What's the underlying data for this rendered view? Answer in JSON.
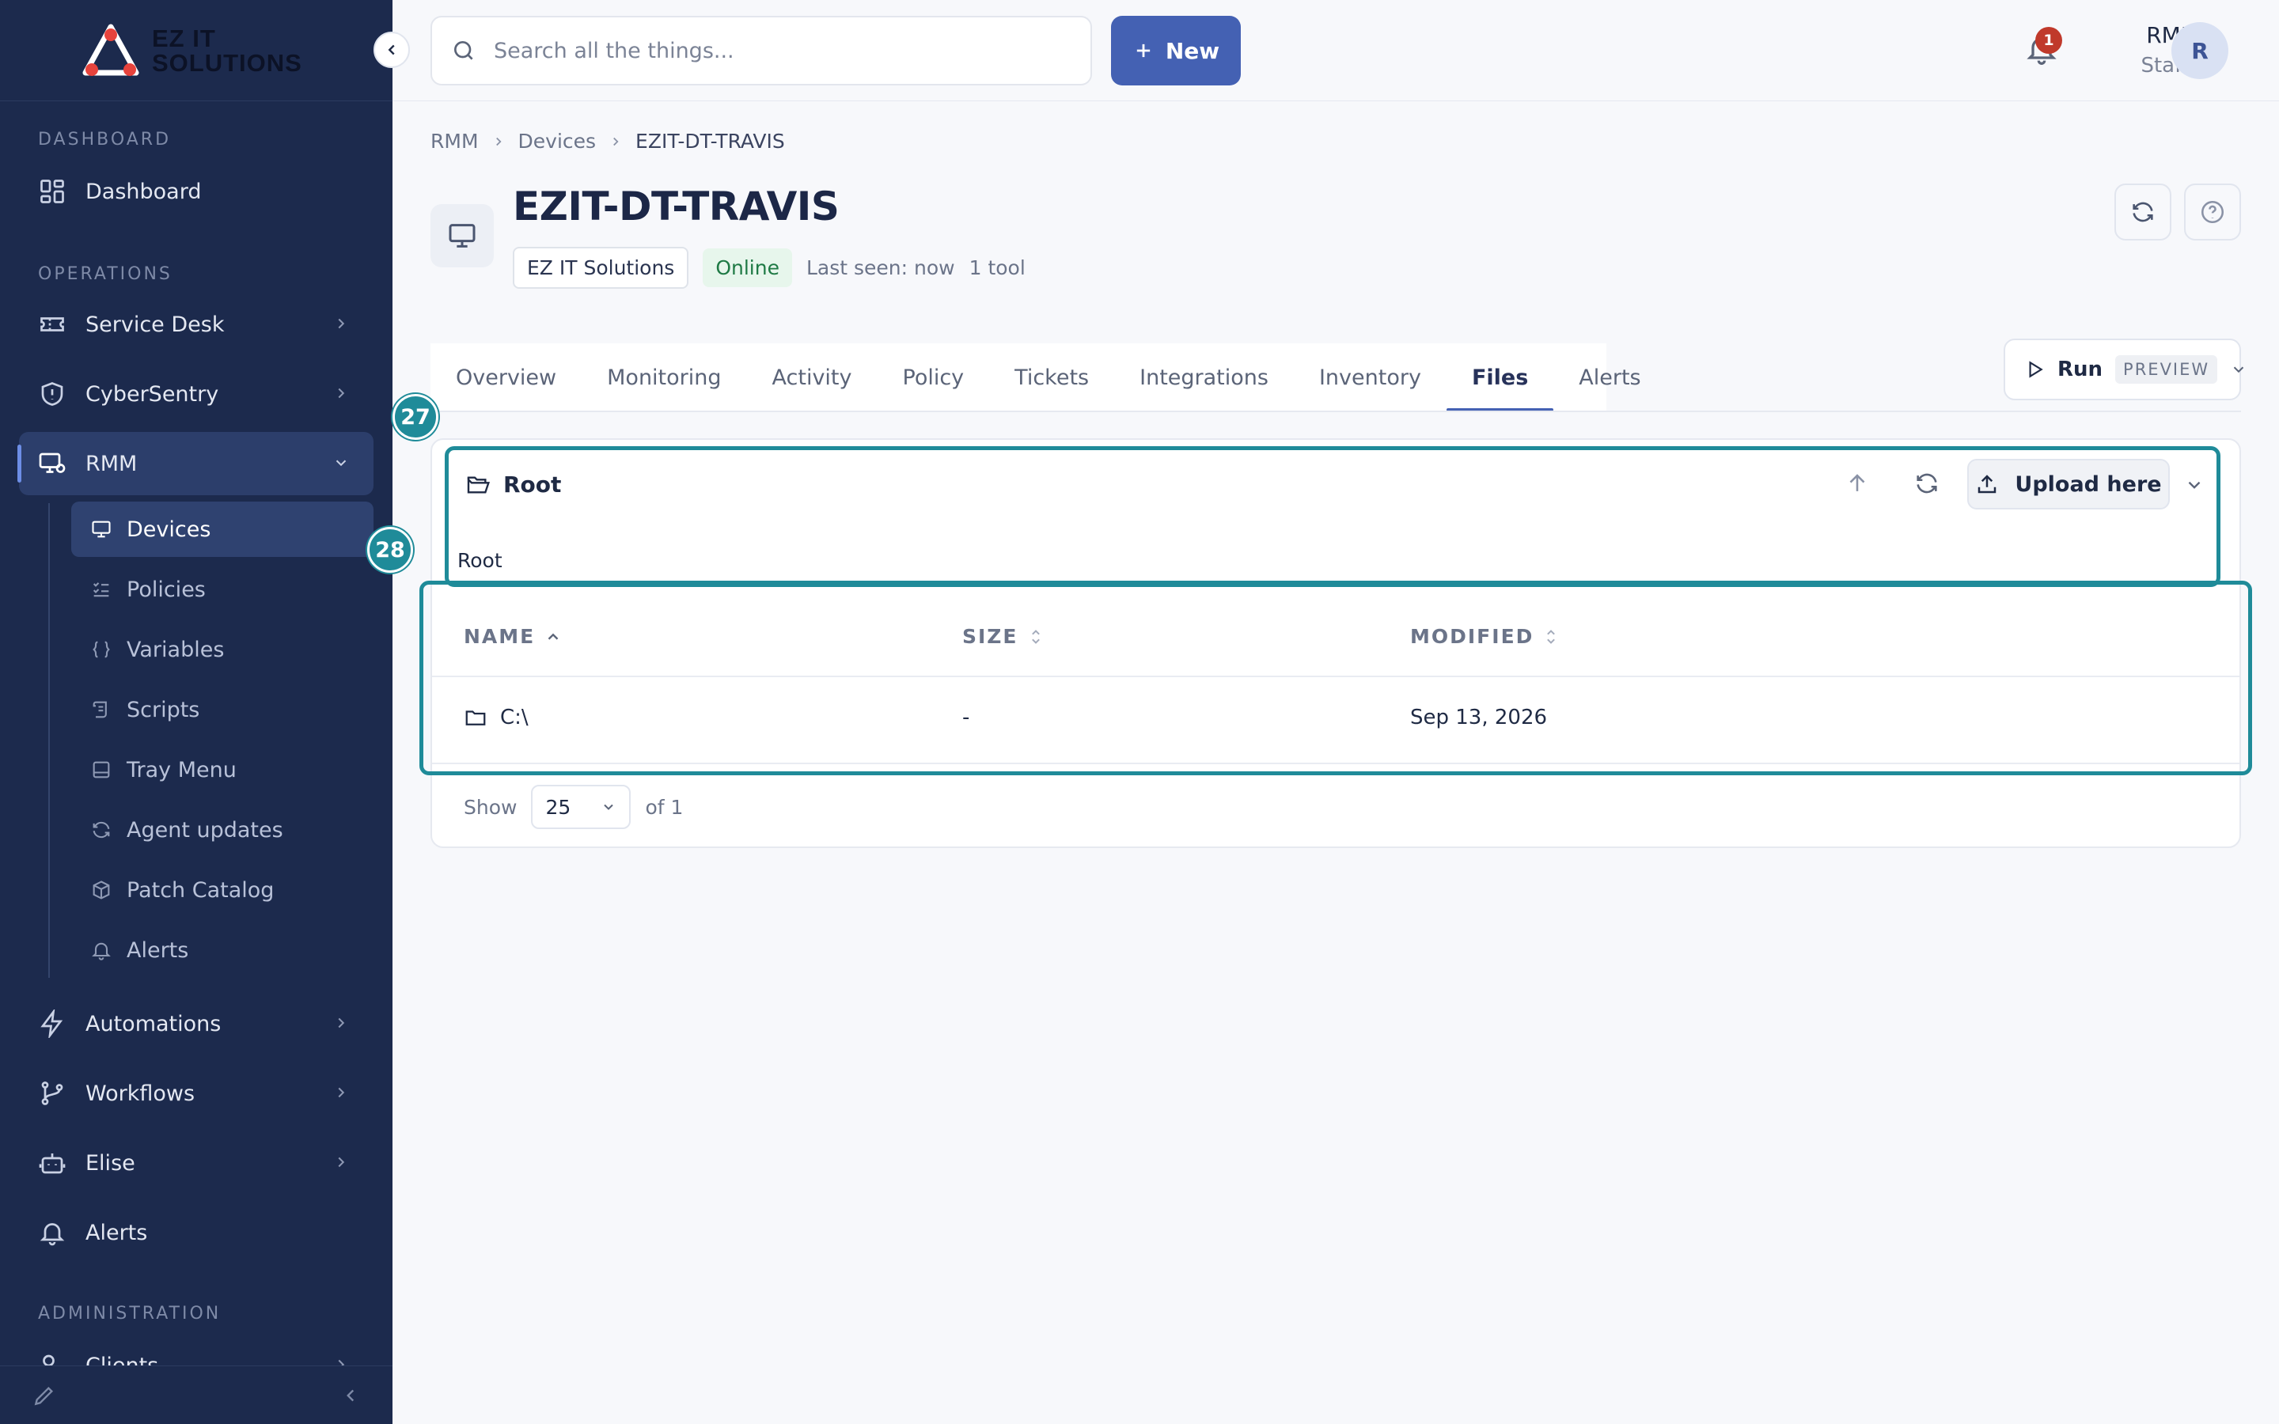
{
  "brand": {
    "line1": "EZ IT",
    "line2": "SOLUTIONS"
  },
  "sidebar": {
    "sections": {
      "dashboard": "DASHBOARD",
      "operations": "OPERATIONS",
      "administration": "ADMINISTRATION"
    },
    "items": {
      "dashboard": "Dashboard",
      "service_desk": "Service Desk",
      "cybersentry": "CyberSentry",
      "rmm": "RMM",
      "automations": "Automations",
      "workflows": "Workflows",
      "elise": "Elise",
      "alerts": "Alerts",
      "clients": "Clients"
    },
    "rmm_sub": {
      "devices": "Devices",
      "policies": "Policies",
      "variables": "Variables",
      "scripts": "Scripts",
      "tray_menu": "Tray Menu",
      "agent_updates": "Agent updates",
      "patch_catalog": "Patch Catalog",
      "alerts": "Alerts"
    }
  },
  "topbar": {
    "search_placeholder": "Search all the things...",
    "new_label": "New",
    "notification_count": "1",
    "user_name": "RMM",
    "user_role": "Staff",
    "avatar_initial": "R"
  },
  "breadcrumb": {
    "level1": "RMM",
    "level2": "Devices",
    "level3": "EZIT-DT-TRAVIS"
  },
  "device": {
    "title": "EZIT-DT-TRAVIS",
    "organization": "EZ IT Solutions",
    "status": "Online",
    "last_seen": "Last seen: now",
    "tools": "1 tool"
  },
  "tabs": {
    "overview": "Overview",
    "monitoring": "Monitoring",
    "activity": "Activity",
    "policy": "Policy",
    "tickets": "Tickets",
    "integrations": "Integrations",
    "inventory": "Inventory",
    "files": "Files",
    "alerts": "Alerts"
  },
  "run": {
    "label": "Run",
    "chip": "PREVIEW"
  },
  "files": {
    "path_title": "Root",
    "upload_label": "Upload here",
    "crumb_root": "Root",
    "columns": {
      "name": "NAME",
      "size": "SIZE",
      "modified": "MODIFIED"
    },
    "rows": [
      {
        "name": "C:\\",
        "size": "-",
        "modified": "Sep 13, 2026"
      }
    ],
    "pager": {
      "show": "Show",
      "page_size": "25",
      "of": "of 1"
    }
  },
  "annotations": {
    "step_a": "27",
    "step_b": "28"
  },
  "colors": {
    "sidebar": "#1c2a4d",
    "accent": "#4461b3",
    "highlight": "#1f8b99",
    "online": "#1f7a45"
  }
}
